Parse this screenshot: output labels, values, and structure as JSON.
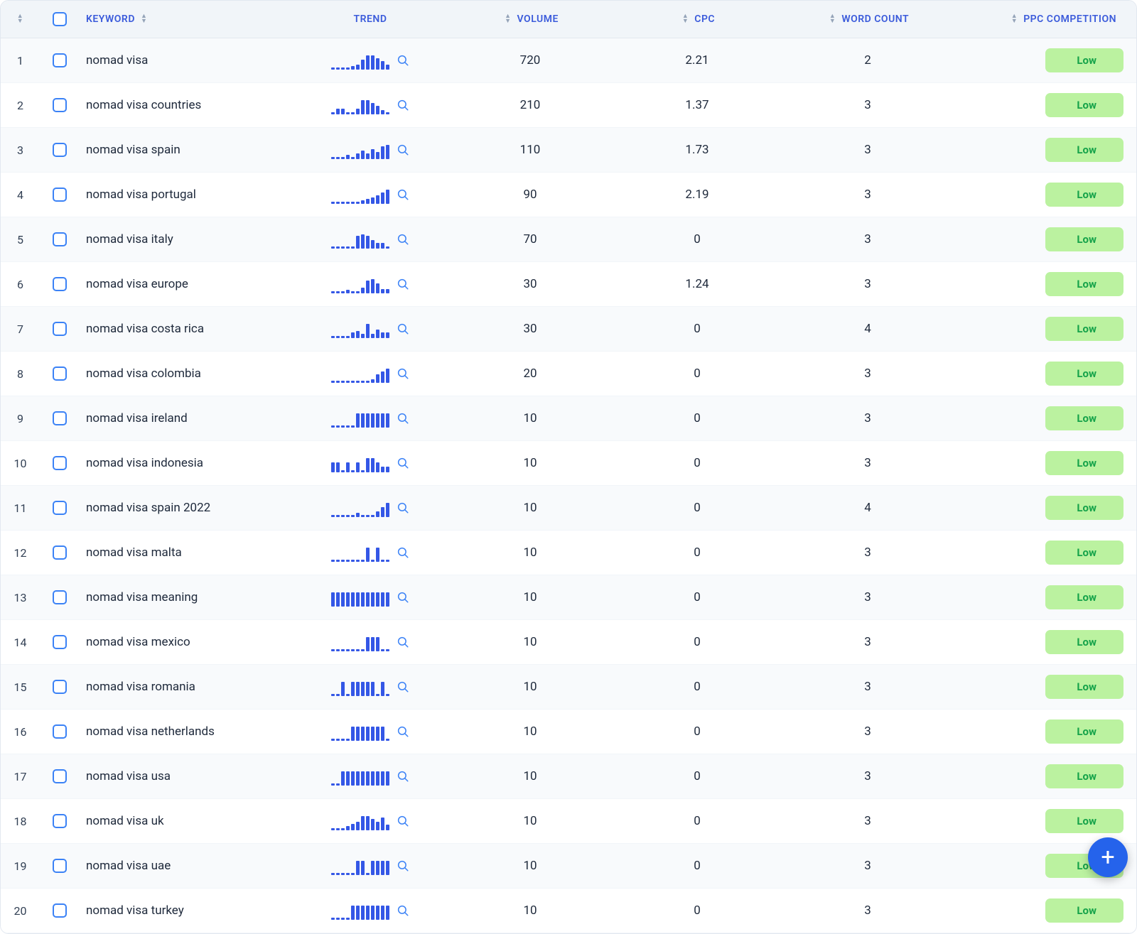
{
  "header": {
    "keyword": "KEYWORD",
    "trend": "TREND",
    "volume": "VOLUME",
    "cpc": "CPC",
    "word_count": "WORD COUNT",
    "ppc": "PPC COMPETITION"
  },
  "badges": {
    "low": "Low"
  },
  "rows": [
    {
      "idx": "1",
      "keyword": "nomad visa",
      "volume": "720",
      "cpc": "2.21",
      "wc": "2",
      "ppc": "low",
      "trend": [
        3,
        3,
        3,
        3,
        5,
        7,
        14,
        20,
        20,
        16,
        12,
        7
      ]
    },
    {
      "idx": "2",
      "keyword": "nomad visa countries",
      "volume": "210",
      "cpc": "1.37",
      "wc": "3",
      "ppc": "low",
      "trend": [
        3,
        8,
        8,
        3,
        3,
        8,
        20,
        20,
        16,
        12,
        6,
        3
      ]
    },
    {
      "idx": "3",
      "keyword": "nomad visa spain",
      "volume": "110",
      "cpc": "1.73",
      "wc": "3",
      "ppc": "low",
      "trend": [
        3,
        3,
        3,
        6,
        3,
        8,
        12,
        8,
        14,
        10,
        18,
        20
      ]
    },
    {
      "idx": "4",
      "keyword": "nomad visa portugal",
      "volume": "90",
      "cpc": "2.19",
      "wc": "3",
      "ppc": "low",
      "trend": [
        3,
        3,
        3,
        3,
        3,
        3,
        5,
        7,
        9,
        12,
        16,
        20
      ]
    },
    {
      "idx": "5",
      "keyword": "nomad visa italy",
      "volume": "70",
      "cpc": "0",
      "wc": "3",
      "ppc": "low",
      "trend": [
        3,
        3,
        3,
        3,
        3,
        18,
        20,
        18,
        12,
        8,
        8,
        3
      ]
    },
    {
      "idx": "6",
      "keyword": "nomad visa europe",
      "volume": "30",
      "cpc": "1.24",
      "wc": "3",
      "ppc": "low",
      "trend": [
        3,
        3,
        3,
        5,
        3,
        3,
        8,
        18,
        20,
        14,
        6,
        6
      ]
    },
    {
      "idx": "7",
      "keyword": "nomad visa costa rica",
      "volume": "30",
      "cpc": "0",
      "wc": "4",
      "ppc": "low",
      "trend": [
        3,
        3,
        3,
        3,
        8,
        10,
        6,
        20,
        6,
        12,
        8,
        8
      ]
    },
    {
      "idx": "8",
      "keyword": "nomad visa colombia",
      "volume": "20",
      "cpc": "0",
      "wc": "3",
      "ppc": "low",
      "trend": [
        3,
        3,
        3,
        3,
        3,
        3,
        3,
        3,
        5,
        12,
        16,
        20
      ]
    },
    {
      "idx": "9",
      "keyword": "nomad visa ireland",
      "volume": "10",
      "cpc": "0",
      "wc": "3",
      "ppc": "low",
      "trend": [
        3,
        3,
        3,
        3,
        3,
        20,
        20,
        20,
        20,
        20,
        20,
        20
      ]
    },
    {
      "idx": "10",
      "keyword": "nomad visa indonesia",
      "volume": "10",
      "cpc": "0",
      "wc": "3",
      "ppc": "low",
      "trend": [
        14,
        14,
        3,
        14,
        3,
        14,
        3,
        20,
        20,
        14,
        8,
        8
      ]
    },
    {
      "idx": "11",
      "keyword": "nomad visa spain 2022",
      "volume": "10",
      "cpc": "0",
      "wc": "4",
      "ppc": "low",
      "trend": [
        3,
        3,
        3,
        3,
        3,
        6,
        3,
        3,
        3,
        8,
        14,
        20
      ]
    },
    {
      "idx": "12",
      "keyword": "nomad visa malta",
      "volume": "10",
      "cpc": "0",
      "wc": "3",
      "ppc": "low",
      "trend": [
        3,
        3,
        3,
        3,
        3,
        3,
        3,
        20,
        3,
        20,
        3,
        3
      ]
    },
    {
      "idx": "13",
      "keyword": "nomad visa meaning",
      "volume": "10",
      "cpc": "0",
      "wc": "3",
      "ppc": "low",
      "trend": [
        20,
        20,
        20,
        20,
        20,
        20,
        20,
        20,
        20,
        20,
        20,
        20
      ]
    },
    {
      "idx": "14",
      "keyword": "nomad visa mexico",
      "volume": "10",
      "cpc": "0",
      "wc": "3",
      "ppc": "low",
      "trend": [
        3,
        3,
        3,
        3,
        3,
        3,
        3,
        20,
        20,
        20,
        3,
        3
      ]
    },
    {
      "idx": "15",
      "keyword": "nomad visa romania",
      "volume": "10",
      "cpc": "0",
      "wc": "3",
      "ppc": "low",
      "trend": [
        3,
        3,
        20,
        3,
        20,
        20,
        20,
        20,
        20,
        3,
        20,
        3
      ]
    },
    {
      "idx": "16",
      "keyword": "nomad visa netherlands",
      "volume": "10",
      "cpc": "0",
      "wc": "3",
      "ppc": "low",
      "trend": [
        3,
        3,
        3,
        3,
        20,
        20,
        20,
        20,
        20,
        20,
        20,
        3
      ]
    },
    {
      "idx": "17",
      "keyword": "nomad visa usa",
      "volume": "10",
      "cpc": "0",
      "wc": "3",
      "ppc": "low",
      "trend": [
        3,
        3,
        20,
        20,
        20,
        20,
        20,
        20,
        20,
        20,
        20,
        20
      ]
    },
    {
      "idx": "18",
      "keyword": "nomad visa uk",
      "volume": "10",
      "cpc": "0",
      "wc": "3",
      "ppc": "low",
      "trend": [
        3,
        3,
        3,
        6,
        9,
        12,
        20,
        20,
        16,
        12,
        18,
        8
      ]
    },
    {
      "idx": "19",
      "keyword": "nomad visa uae",
      "volume": "10",
      "cpc": "0",
      "wc": "3",
      "ppc": "low",
      "trend": [
        3,
        3,
        3,
        3,
        3,
        20,
        20,
        3,
        20,
        20,
        20,
        20
      ]
    },
    {
      "idx": "20",
      "keyword": "nomad visa turkey",
      "volume": "10",
      "cpc": "0",
      "wc": "3",
      "ppc": "low",
      "trend": [
        3,
        3,
        3,
        3,
        20,
        20,
        20,
        20,
        20,
        20,
        20,
        20
      ]
    }
  ]
}
